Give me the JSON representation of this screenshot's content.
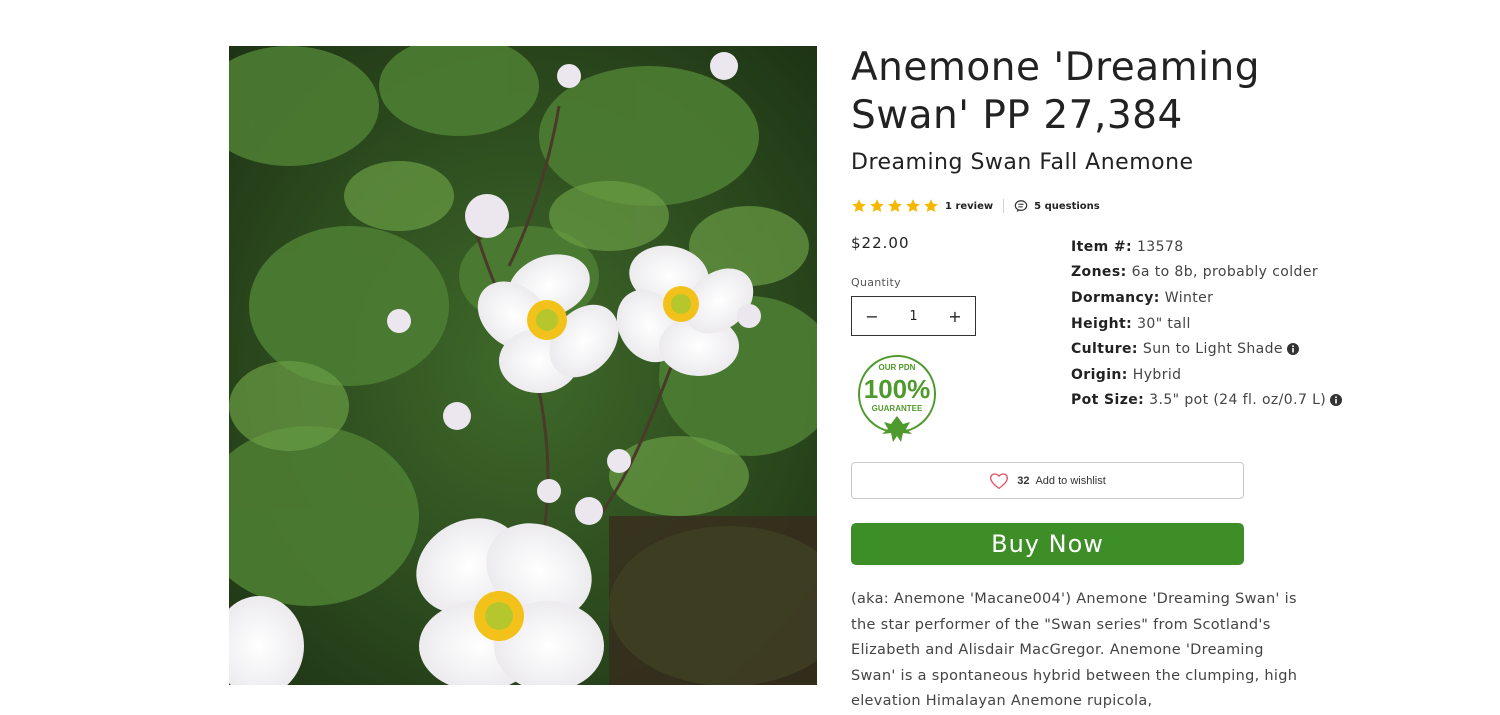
{
  "product": {
    "title": "Anemone 'Dreaming Swan' PP 27,384",
    "common_name": "Dreaming Swan Fall Anemone",
    "rating_stars": 5,
    "review_count_label": "1 review",
    "questions_label": "5 questions",
    "price": "$22.00",
    "quantity_label": "Quantity",
    "quantity_value": "1",
    "guarantee_badge": {
      "top": "OUR PDN",
      "big": "100%",
      "bottom": "GUARANTEE"
    }
  },
  "specs": [
    {
      "key": "Item #:",
      "value": "13578",
      "info": false
    },
    {
      "key": "Zones:",
      "value": "6a to 8b, probably colder",
      "info": false
    },
    {
      "key": "Dormancy:",
      "value": "Winter",
      "info": false
    },
    {
      "key": "Height:",
      "value": "30\" tall",
      "info": false
    },
    {
      "key": "Culture:",
      "value": "Sun to Light Shade",
      "info": true
    },
    {
      "key": "Origin:",
      "value": "Hybrid",
      "info": false
    },
    {
      "key": "Pot Size:",
      "value": "3.5\" pot (24 fl. oz/0.7 L)",
      "info": true
    }
  ],
  "wishlist": {
    "count": "32",
    "label": "Add to wishlist"
  },
  "buy_now_label": "Buy Now",
  "description": "(aka: Anemone 'Macane004') Anemone 'Dreaming Swan' is the star performer of the \"Swan series\" from Scotland's Elizabeth and Alisdair MacGregor. Anemone 'Dreaming Swan' is a spontaneous hybrid between the clumping, high elevation Himalayan Anemone rupicola,",
  "colors": {
    "star": "#f5b700",
    "buy_button": "#3e8e28",
    "guarantee_green": "#4f9a2c",
    "heart": "#e05263"
  }
}
